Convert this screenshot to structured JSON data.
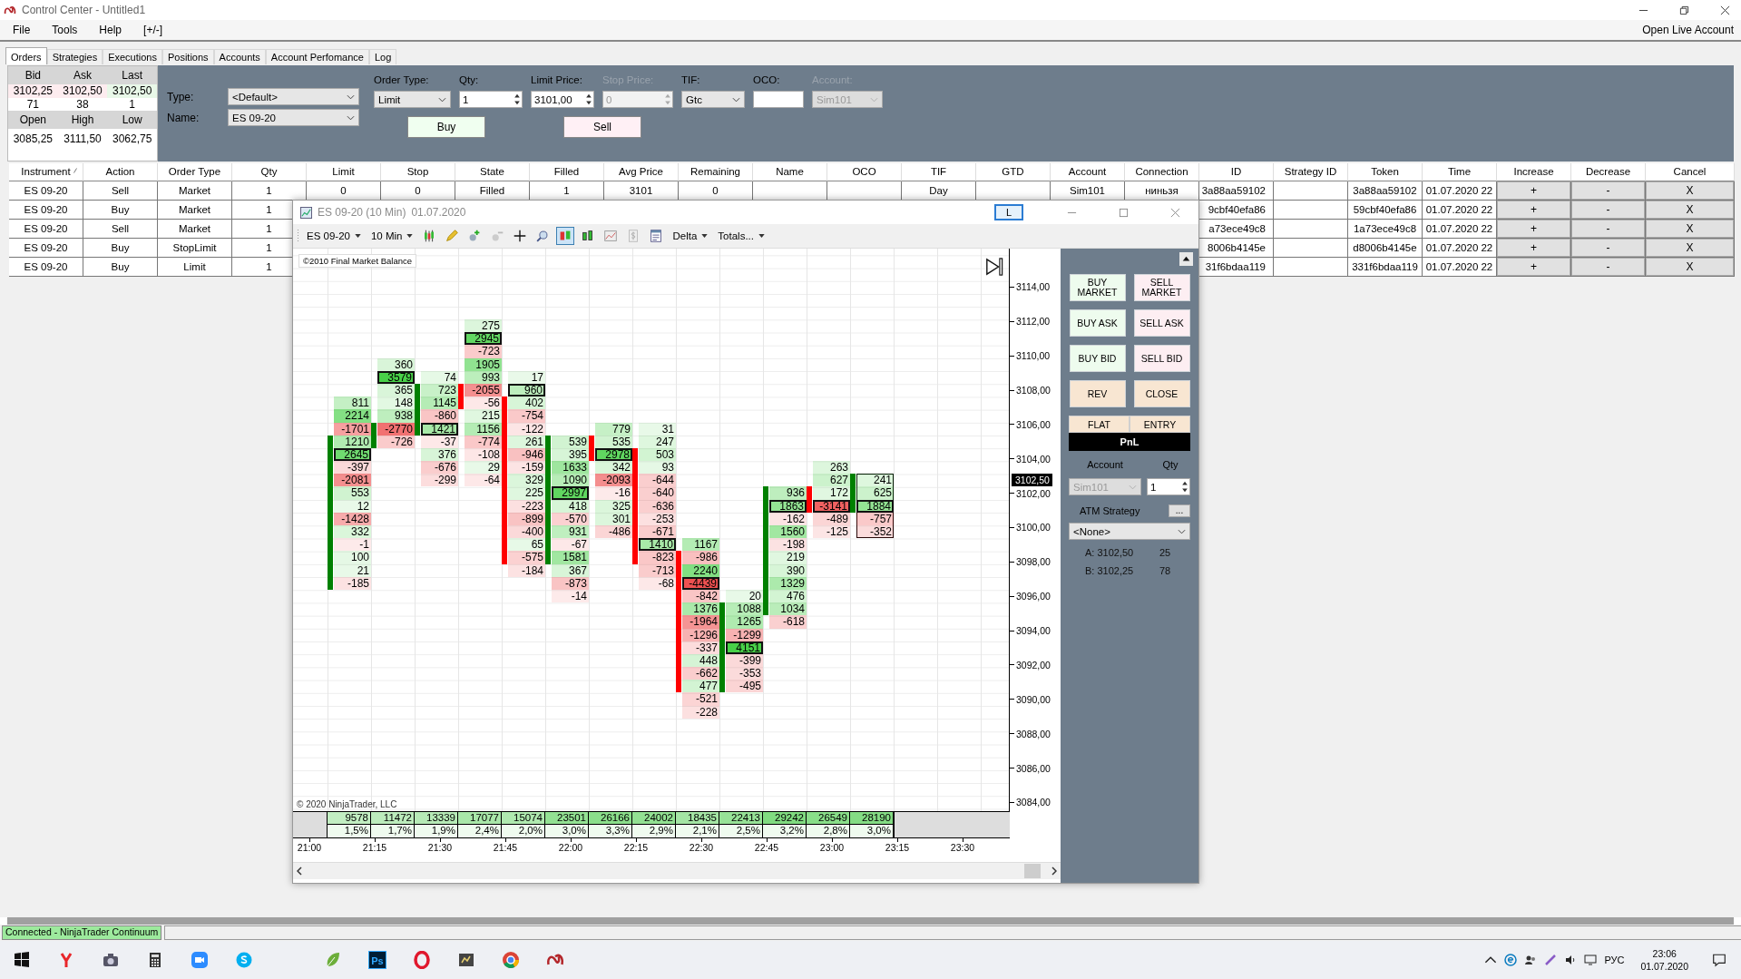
{
  "window": {
    "title": "Control Center - Untitled1"
  },
  "menu": [
    "File",
    "Tools",
    "Help",
    "[+/-]"
  ],
  "open_live_account": "Open Live Account",
  "tabs": [
    {
      "label": "Orders",
      "selected": true
    },
    {
      "label": "Strategies",
      "selected": false
    },
    {
      "label": "Executions",
      "selected": false
    },
    {
      "label": "Positions",
      "selected": false
    },
    {
      "label": "Accounts",
      "selected": false
    },
    {
      "label": "Account Perfomance",
      "selected": false
    },
    {
      "label": "Log",
      "selected": false
    }
  ],
  "quote": {
    "headers": [
      "Bid",
      "Ask",
      "Last"
    ],
    "prices": [
      "3102,25",
      "3102,50",
      "3102,50"
    ],
    "sizes": [
      "71",
      "38",
      "1"
    ],
    "range_headers": [
      "Open",
      "High",
      "Low"
    ],
    "range_values": [
      "3085,25",
      "3111,50",
      "3062,75"
    ]
  },
  "order_entry": {
    "type": {
      "label": "Type:",
      "value": "<Default>"
    },
    "name": {
      "label": "Name:",
      "value": "ES 09-20"
    },
    "fields": [
      {
        "label": "Order Type:",
        "value": "Limit",
        "kind": "combo",
        "disabled": false
      },
      {
        "label": "Qty:",
        "value": "1",
        "kind": "spin",
        "disabled": false
      },
      {
        "label": "Limit Price:",
        "value": "3101,00",
        "kind": "spin",
        "disabled": false
      },
      {
        "label": "Stop Price:",
        "value": "0",
        "kind": "spin",
        "disabled": true
      },
      {
        "label": "TIF:",
        "value": "Gtc",
        "kind": "combo",
        "disabled": false
      },
      {
        "label": "OCO:",
        "kind": "text",
        "disabled": false
      },
      {
        "label": "Account:",
        "value": "Sim101",
        "kind": "combo",
        "disabled": true
      }
    ],
    "buttons": [
      {
        "label": "Buy",
        "kind": "buy"
      },
      {
        "label": "Sell",
        "kind": "sell"
      }
    ]
  },
  "orders": {
    "columns": [
      {
        "label": "Instrument",
        "kind": "text"
      },
      {
        "label": "Action",
        "kind": "text"
      },
      {
        "label": "Order Type",
        "kind": "text"
      },
      {
        "label": "Qty",
        "kind": "text"
      },
      {
        "label": "Limit",
        "kind": "text"
      },
      {
        "label": "Stop",
        "kind": "text"
      },
      {
        "label": "State",
        "kind": "text"
      },
      {
        "label": "Filled",
        "kind": "text"
      },
      {
        "label": "Avg Price",
        "kind": "text"
      },
      {
        "label": "Remaining",
        "kind": "text"
      },
      {
        "label": "Name",
        "kind": "text"
      },
      {
        "label": "OCO",
        "kind": "text"
      },
      {
        "label": "TIF",
        "kind": "text"
      },
      {
        "label": "GTD",
        "kind": "text"
      },
      {
        "label": "Account",
        "kind": "text"
      },
      {
        "label": "Connection",
        "kind": "text"
      },
      {
        "label": "ID",
        "kind": "id"
      },
      {
        "label": "Strategy ID",
        "kind": "text"
      },
      {
        "label": "Token",
        "kind": "text"
      },
      {
        "label": "Time",
        "kind": "text"
      },
      {
        "label": "Increase",
        "kind": "button"
      },
      {
        "label": "Decrease",
        "kind": "button"
      },
      {
        "label": "Cancel",
        "kind": "button"
      }
    ],
    "rows": [
      {
        "instrument": "ES 09-20",
        "action": "Sell",
        "order_type": "Market",
        "qty": "1",
        "limit": "0",
        "stop": "0",
        "state": "Filled",
        "filled": "1",
        "avg_price": "3101",
        "remaining": "0",
        "tif": "Day",
        "account": "Sim101",
        "connection": "ниньзя",
        "id": "3a88aa59102",
        "token": "3a88aa59102",
        "time": "01.07.2020 22",
        "increase": "+",
        "decrease": "-",
        "cancel": "X"
      },
      {
        "instrument": "ES 09-20",
        "action": "Buy",
        "order_type": "Market",
        "qty": "1",
        "id": "9cbf40efa86",
        "token": "59cbf40efa86",
        "time": "01.07.2020 22",
        "increase": "+",
        "decrease": "-",
        "cancel": "X"
      },
      {
        "instrument": "ES 09-20",
        "action": "Sell",
        "order_type": "Market",
        "qty": "1",
        "id": "a73ece49c8",
        "token": "1a73ece49c8",
        "time": "01.07.2020 22",
        "increase": "+",
        "decrease": "-",
        "cancel": "X"
      },
      {
        "instrument": "ES 09-20",
        "action": "Buy",
        "order_type": "StopLimit",
        "qty": "1",
        "id": "8006b4145e",
        "token": "d8006b4145e",
        "time": "01.07.2020 22",
        "increase": "+",
        "decrease": "-",
        "cancel": "X"
      },
      {
        "instrument": "ES 09-20",
        "action": "Buy",
        "order_type": "Limit",
        "qty": "1",
        "id": "31f6bdaa119",
        "token": "331f6bdaa119",
        "time": "01.07.2020 22",
        "increase": "+",
        "decrease": "-",
        "cancel": "X"
      }
    ]
  },
  "chart_window": {
    "title": "ES 09-20 (10 Min)",
    "date": "01.07.2020",
    "link_button": "L",
    "toolbar": {
      "instrument": "ES 09-20",
      "period": "10 Min",
      "indicator": "Delta",
      "totals": "Totals...",
      "tools": [
        {
          "kind": "candles",
          "selected": false
        },
        {
          "kind": "pencil",
          "selected": false
        },
        {
          "kind": "add",
          "selected": false
        },
        {
          "kind": "remove",
          "selected": false
        },
        {
          "kind": "crosshair",
          "selected": false
        },
        {
          "kind": "zoom",
          "selected": false
        },
        {
          "kind": "footprint",
          "selected": true
        },
        {
          "kind": "bars",
          "selected": false
        },
        {
          "kind": "area",
          "selected": false
        },
        {
          "kind": "dollar",
          "selected": false
        },
        {
          "kind": "properties",
          "selected": false
        }
      ]
    },
    "indicator_label": "©2010 Final Market Balance",
    "footprint": {
      "columns": [
        {
          "rising": true,
          "current": false,
          "above": [
            "811",
            "2214",
            "-1701"
          ],
          "body": [
            "1210",
            "2645",
            "-397",
            "-2081",
            "553",
            "12",
            "-1428",
            "332",
            "-1",
            "100",
            "21",
            "-185"
          ],
          "total": "9578",
          "percent": "1,5%"
        },
        {
          "rising": true,
          "current": false,
          "above": [
            "360",
            "3579",
            "365",
            "148",
            "938"
          ],
          "body": [
            "-2770",
            "-726"
          ],
          "total": "11472",
          "percent": "1,7%"
        },
        {
          "rising": true,
          "current": false,
          "above": [
            "74"
          ],
          "body": [
            "723",
            "1145",
            "-860",
            "1421"
          ],
          "below": [
            "-37",
            "376",
            "-676",
            "-299"
          ],
          "total": "13339",
          "percent": "1,9%"
        },
        {
          "rising": false,
          "current": false,
          "above": [
            "275",
            "2945",
            "-723",
            "1905",
            "993"
          ],
          "body": [
            "-2055",
            "-56"
          ],
          "below": [
            "215",
            "1156",
            "-774",
            "-108",
            "29",
            "-64"
          ],
          "total": "17077",
          "percent": "2,4%"
        },
        {
          "rising": false,
          "current": false,
          "above": [
            "17",
            "960"
          ],
          "body": [
            "402",
            "-754",
            "-122",
            "261",
            "-946",
            "-159",
            "329",
            "225",
            "-223",
            "-899",
            "-400",
            "65",
            "-575"
          ],
          "below": [
            "-184"
          ],
          "total": "15074",
          "percent": "2,0%"
        },
        {
          "rising": true,
          "current": false,
          "body": [
            "539",
            "395",
            "1633",
            "1090",
            "2997",
            "418",
            "-570",
            "931",
            "-67",
            "1581"
          ],
          "below": [
            "367",
            "-873",
            "-14"
          ],
          "total": "23501",
          "percent": "3,0%"
        },
        {
          "rising": false,
          "current": false,
          "above": [
            "779"
          ],
          "body": [
            "535",
            "2978"
          ],
          "below": [
            "342",
            "-2093",
            "-16",
            "325",
            "301",
            "-486"
          ],
          "total": "26166",
          "percent": "3,3%"
        },
        {
          "rising": false,
          "current": false,
          "above": [
            "31",
            "247"
          ],
          "body": [
            "503",
            "93",
            "-644",
            "-640",
            "-636",
            "-253",
            "-671",
            "1410",
            "-823"
          ],
          "below": [
            "-713",
            "-68"
          ],
          "total": "24002",
          "percent": "2,9%"
        },
        {
          "rising": false,
          "current": false,
          "above": [
            "1167"
          ],
          "body": [
            "-986",
            "2240",
            "-4439",
            "-842",
            "1376",
            "-1964",
            "-1296",
            "-337",
            "448",
            "-662",
            "477"
          ],
          "below": [
            "-521",
            "-228"
          ],
          "total": "18435",
          "percent": "2,1%"
        },
        {
          "rising": true,
          "current": false,
          "above": [
            "20"
          ],
          "body": [
            "1088",
            "1265",
            "-1299",
            "4151",
            "-399",
            "-353",
            "-495"
          ],
          "total": "22413",
          "percent": "2,5%"
        },
        {
          "rising": true,
          "current": false,
          "body": [
            "936",
            "1863",
            "-162",
            "1560",
            "-198",
            "219",
            "390",
            "1329",
            "476",
            "1034"
          ],
          "below": [
            "-618"
          ],
          "total": "29242",
          "percent": "3,2%"
        },
        {
          "rising": false,
          "current": false,
          "above": [
            "263",
            "627"
          ],
          "body": [
            "172",
            "-3141"
          ],
          "below": [
            "-489",
            "-125"
          ],
          "total": "26549",
          "percent": "2,8%"
        },
        {
          "rising": true,
          "current": true,
          "body": [
            "241",
            "625",
            "1884"
          ],
          "below": [
            "-757",
            "-352"
          ],
          "total": "28190",
          "percent": "3,0%"
        }
      ]
    },
    "price_axis": [
      "3114,00",
      "3112,00",
      "3110,00",
      "3108,00",
      "3106,00",
      "3104,00",
      "3102,00",
      "3100,00",
      "3098,00",
      "3096,00",
      "3094,00",
      "3092,00",
      "3090,00",
      "3088,00",
      "3086,00",
      "3084,00"
    ],
    "last_price": "3102,50",
    "time_axis": [
      "21:00",
      "21:15",
      "21:30",
      "21:45",
      "22:00",
      "22:15",
      "22:30",
      "22:45",
      "23:00",
      "23:15",
      "23:30"
    ],
    "copyright": "© 2020 NinjaTrader, LLC",
    "chart_trader": {
      "buttons": [
        {
          "label": "BUY MARKET",
          "kind": "buy"
        },
        {
          "label": "SELL MARKET",
          "kind": "sell"
        },
        {
          "label": "BUY ASK",
          "kind": "buy"
        },
        {
          "label": "SELL ASK",
          "kind": "sell"
        },
        {
          "label": "BUY BID",
          "kind": "buy"
        },
        {
          "label": "SELL BID",
          "kind": "sell"
        },
        {
          "label": "REV",
          "kind": "neutral"
        },
        {
          "label": "CLOSE",
          "kind": "neutral"
        }
      ],
      "position_tabs": [
        "FLAT",
        "ENTRY"
      ],
      "pnl": "PnL",
      "account_label": "Account",
      "qty_label": "Qty",
      "account": "Sim101",
      "qty": "1",
      "atm_label": "ATM Strategy",
      "atm_button": "...",
      "atm_value": "<None>",
      "quotes": [
        {
          "label": "A: 3102,50",
          "size": "25"
        },
        {
          "label": "B: 3102,25",
          "size": "78"
        }
      ]
    }
  },
  "status": {
    "text": "Connected - NinjaTrader Continuum",
    "connected": true
  },
  "taskbar": {
    "apps": [
      {
        "kind": "yandex"
      },
      {
        "kind": "camera"
      },
      {
        "kind": "calculator"
      },
      {
        "kind": "video"
      },
      {
        "kind": "skype"
      },
      {
        "kind": "leaf"
      },
      {
        "kind": "photoshop",
        "label": "Ps"
      },
      {
        "kind": "opera"
      },
      {
        "kind": "app"
      },
      {
        "kind": "chrome"
      },
      {
        "kind": "ninja"
      }
    ],
    "language": "РУС",
    "time": "23:06",
    "date": "01.07.2020"
  }
}
